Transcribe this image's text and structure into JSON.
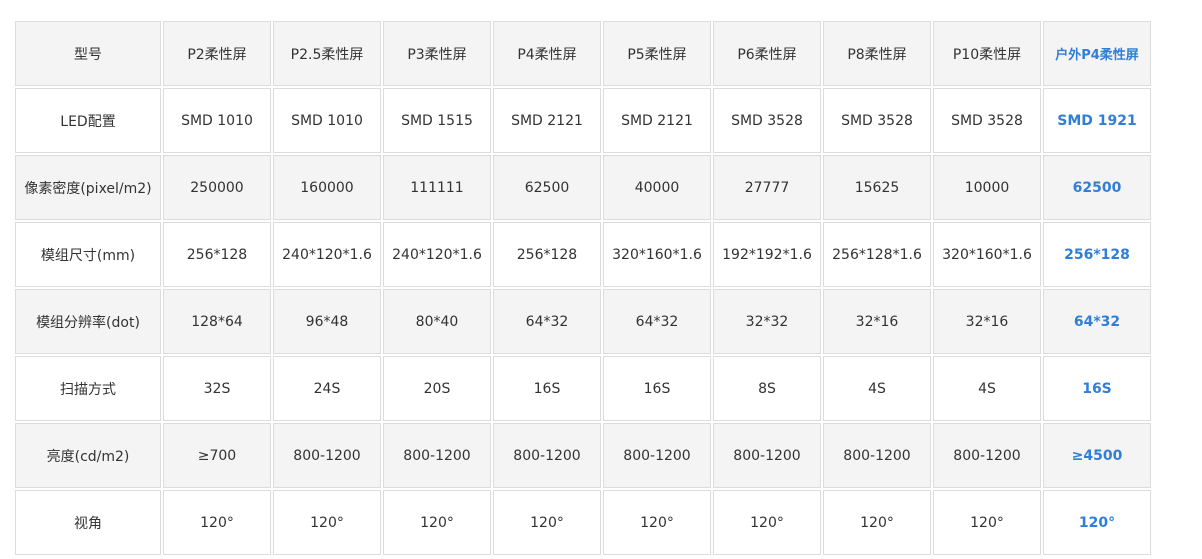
{
  "table": {
    "header": [
      "型号",
      "P2柔性屏",
      "P2.5柔性屏",
      "P3柔性屏",
      "P4柔性屏",
      "P5柔性屏",
      "P6柔性屏",
      "P8柔性屏",
      "P10柔性屏",
      "户外P4柔性屏"
    ],
    "rows": [
      {
        "label": "LED配置",
        "cells": [
          "SMD 1010",
          "SMD 1010",
          "SMD 1515",
          "SMD 2121",
          "SMD 2121",
          "SMD 3528",
          "SMD 3528",
          "SMD 3528",
          "SMD 1921"
        ]
      },
      {
        "label": "像素密度(pixel/m2)",
        "cells": [
          "250000",
          "160000",
          "111111",
          "62500",
          "40000",
          "27777",
          "15625",
          "10000",
          "62500"
        ]
      },
      {
        "label": "模组尺寸(mm)",
        "cells": [
          "256*128",
          "240*120*1.6",
          "240*120*1.6",
          "256*128",
          "320*160*1.6",
          "192*192*1.6",
          "256*128*1.6",
          "320*160*1.6",
          "256*128"
        ]
      },
      {
        "label": "模组分辨率(dot)",
        "cells": [
          "128*64",
          "96*48",
          "80*40",
          "64*32",
          "64*32",
          "32*32",
          "32*16",
          "32*16",
          "64*32"
        ]
      },
      {
        "label": "扫描方式",
        "cells": [
          "32S",
          "24S",
          "20S",
          "16S",
          "16S",
          "8S",
          "4S",
          "4S",
          "16S"
        ]
      },
      {
        "label": "亮度(cd/m2)",
        "cells": [
          "≥700",
          "800-1200",
          "800-1200",
          "800-1200",
          "800-1200",
          "800-1200",
          "800-1200",
          "800-1200",
          "≥4500"
        ]
      },
      {
        "label": "视角",
        "cells": [
          "120°",
          "120°",
          "120°",
          "120°",
          "120°",
          "120°",
          "120°",
          "120°",
          "120°"
        ]
      }
    ]
  },
  "colors": {
    "highlight": "#2f7ed8",
    "shaded_row": "#f4f4f4",
    "border": "#dcdcdc"
  }
}
